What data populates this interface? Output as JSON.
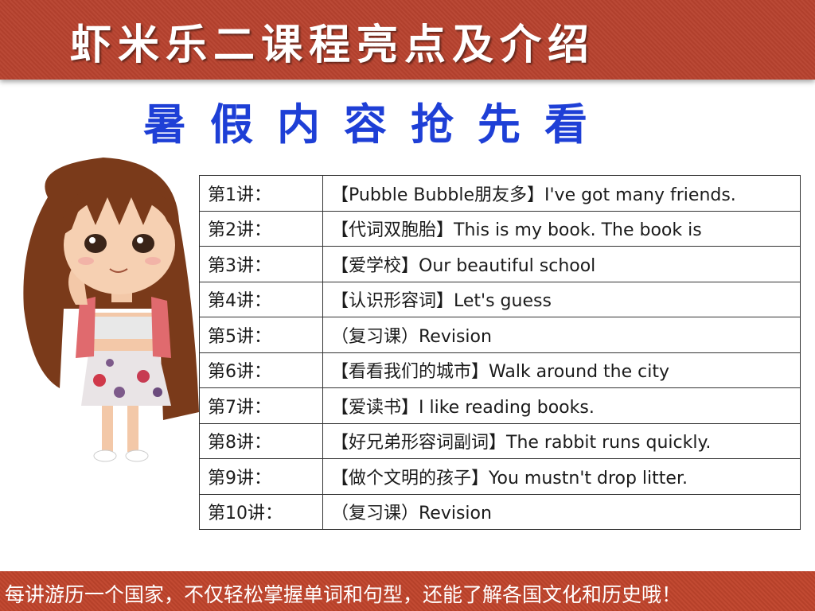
{
  "header": {
    "title": "虾米乐二课程亮点及介绍"
  },
  "subtitle": "暑假内容抢先看",
  "lessons": [
    {
      "num": "第1讲：",
      "title": "【Pubble Bubble朋友多】I've got many friends."
    },
    {
      "num": "第2讲：",
      "title": "【代词双胞胎】This is my book. The book is"
    },
    {
      "num": "第3讲：",
      "title": "【爱学校】Our beautiful school"
    },
    {
      "num": "第4讲：",
      "title": "【认识形容词】Let's guess"
    },
    {
      "num": "第5讲：",
      "title": "（复习课）Revision"
    },
    {
      "num": "第6讲：",
      "title": "【看看我们的城市】Walk around the city"
    },
    {
      "num": "第7讲：",
      "title": "【爱读书】I like reading books."
    },
    {
      "num": "第8讲：",
      "title": "【好兄弟形容词副词】The rabbit runs quickly."
    },
    {
      "num": "第9讲：",
      "title": "【做个文明的孩子】You mustn't drop litter."
    },
    {
      "num": "第10讲：",
      "title": "（复习课）Revision"
    }
  ],
  "footer": {
    "text": "每讲游历一个国家，不仅轻松掌握单词和句型，还能了解各国文化和历史哦！"
  },
  "colors": {
    "banner": "#b8432f",
    "subtitle": "#1e3fd6"
  }
}
